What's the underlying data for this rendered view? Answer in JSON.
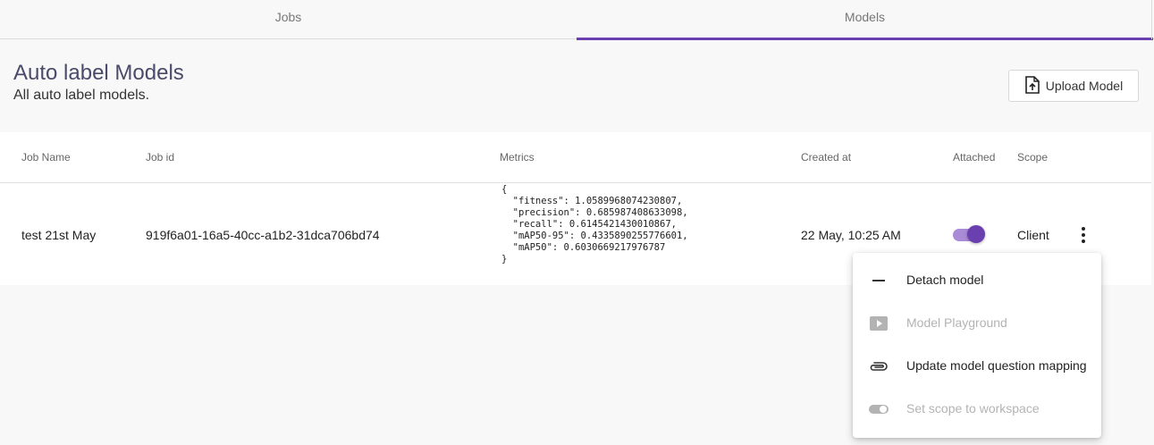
{
  "tabs": [
    {
      "label": "Jobs",
      "active": false
    },
    {
      "label": "Models",
      "active": true
    }
  ],
  "header": {
    "title": "Auto label Models",
    "subtitle": "All auto label models.",
    "upload_label": "Upload Model"
  },
  "table": {
    "columns": [
      "Job Name",
      "Job id",
      "Metrics",
      "Created at",
      "Attached",
      "Scope"
    ],
    "rows": [
      {
        "job_name": "test 21st May",
        "job_id": "919f6a01-16a5-40cc-a1b2-31dca706bd74",
        "metrics": "{\n  \"fitness\": 1.0589968074230807,\n  \"precision\": 0.685987408633098,\n  \"recall\": 0.6145421430010867,\n  \"mAP50-95\": 0.4335890255776601,\n  \"mAP50\": 0.6030669217976787\n}",
        "created_at": "22 May, 10:25 AM",
        "attached": true,
        "scope": "Client"
      }
    ]
  },
  "menu": {
    "items": [
      {
        "label": "Detach model",
        "icon": "minus-icon",
        "disabled": false
      },
      {
        "label": "Model Playground",
        "icon": "play-icon",
        "disabled": true
      },
      {
        "label": "Update model question mapping",
        "icon": "paperclip-icon",
        "disabled": false
      },
      {
        "label": "Set scope to workspace",
        "icon": "toggle-icon",
        "disabled": true
      }
    ]
  },
  "colors": {
    "accent": "#6a3fb0",
    "accent_light": "#a98bd6",
    "title": "#4a4a6a"
  }
}
